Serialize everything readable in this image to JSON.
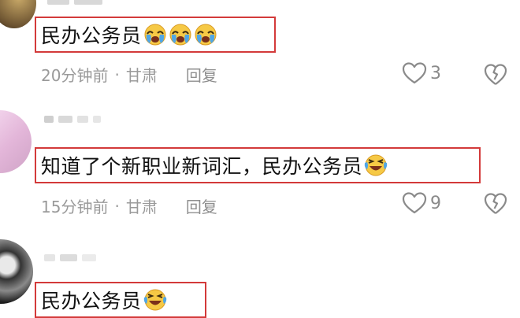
{
  "comments": [
    {
      "text": "民办公务员",
      "emoji_icons": [
        "crying-face-icon",
        "crying-face-icon",
        "crying-face-icon"
      ],
      "time": "20分钟前",
      "location": "甘肃",
      "reply_label": "回复",
      "like_count": "3"
    },
    {
      "text": "知道了个新职业新词汇，民办公务员",
      "emoji_icons": [
        "laughing-tears-icon"
      ],
      "time": "15分钟前",
      "location": "甘肃",
      "reply_label": "回复",
      "like_count": "9"
    },
    {
      "text": "民办公务员",
      "emoji_icons": [
        "laughing-tears-icon"
      ]
    }
  ],
  "meta_separator": "·",
  "colors": {
    "highlight_border": "#d33a3a",
    "meta_text": "#9a9a9a"
  }
}
